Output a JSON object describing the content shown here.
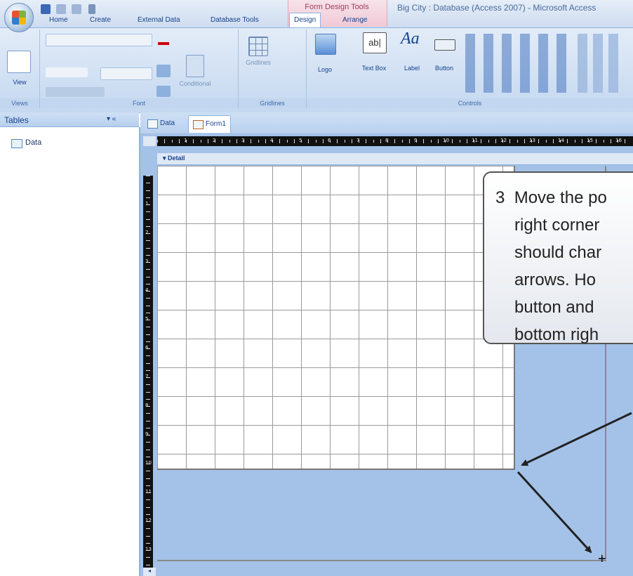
{
  "window": {
    "title": "Big City : Database (Access 2007) - Microsoft Access",
    "contextual_group": "Form Design Tools"
  },
  "ribbon_tabs": [
    "Home",
    "Create",
    "External Data",
    "Database Tools",
    "Design",
    "Arrange"
  ],
  "ribbon_active_tab": "Design",
  "ribbon_groups": {
    "views": {
      "label": "Views",
      "view_button": "View"
    },
    "font": {
      "label": "Font",
      "conditional": "Conditional"
    },
    "gridlines": {
      "label": "Gridlines",
      "gridlines_button": "Gridlines"
    },
    "controls": {
      "label": "Controls",
      "logo": "Logo",
      "text_box": "Text Box",
      "label_tool": "Label",
      "button": "Button",
      "abl_glyph": "ab|",
      "aa_glyph": "Aa"
    }
  },
  "nav_pane": {
    "title": "Tables",
    "items": [
      "Data"
    ]
  },
  "doc_tabs": [
    "Data",
    "Form1"
  ],
  "active_doc_tab": "Form1",
  "design": {
    "section_label": "Detail",
    "hruler_numbers": [
      "1",
      "2",
      "3",
      "4",
      "5",
      "6",
      "7",
      "8",
      "9",
      "10",
      "11",
      "12",
      "13",
      "14",
      "15",
      "16"
    ],
    "vruler_numbers": [
      "1",
      "2",
      "3",
      "4",
      "5",
      "6",
      "7",
      "8",
      "9",
      "10",
      "11",
      "12",
      "13"
    ]
  },
  "callout": {
    "step": "3",
    "lines": [
      "Move the po",
      "right corner",
      "should char",
      "arrows.  Ho",
      "button and",
      "bottom righ"
    ]
  },
  "colors": {
    "ribbon_text": "#15428b",
    "design_surface": "#a4c2e8",
    "grid_lines": "#9a9a9a",
    "contextual_tab": "#f0c9d6"
  }
}
